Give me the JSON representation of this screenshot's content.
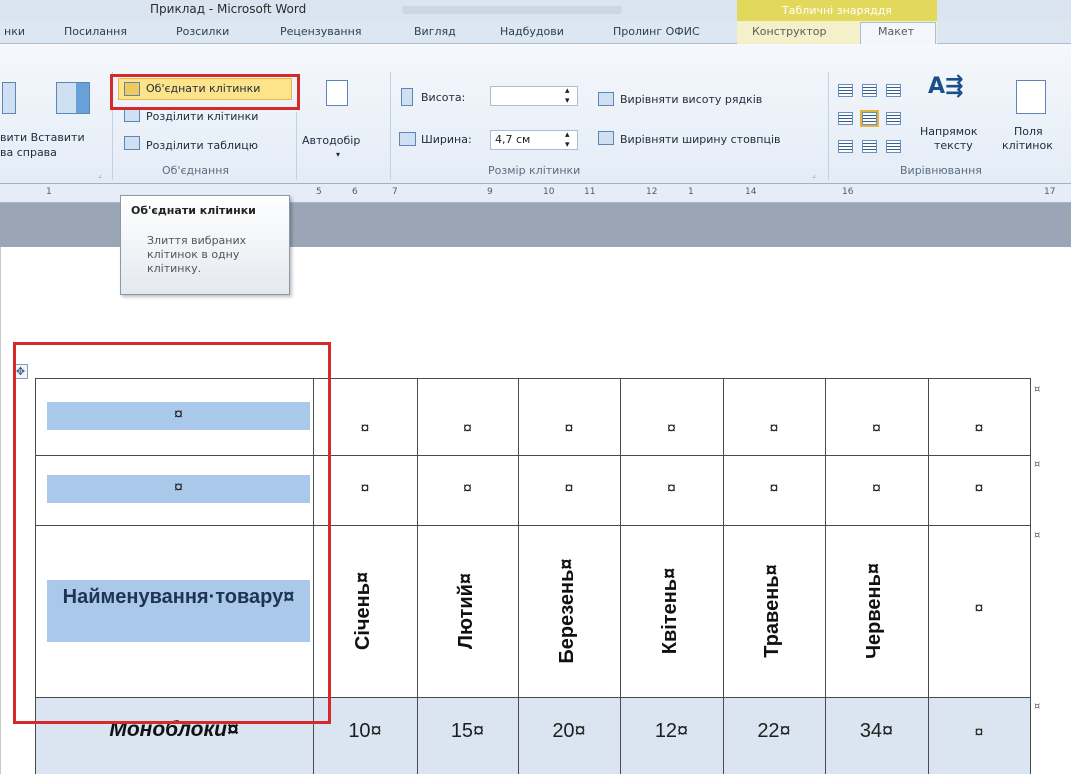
{
  "window": {
    "title": "Приклад - Microsoft Word",
    "context_tools": "Табличні знаряддя"
  },
  "tabs": [
    "нки",
    "Посилання",
    "Розсилки",
    "Рецензування",
    "Вигляд",
    "Надбудови",
    "Пролинг ОФИС",
    "Конструктор",
    "Макет"
  ],
  "ribbon": {
    "insert_right_1": "вити Вставити",
    "insert_right_2": "ва   справа",
    "merge_cells": "Об'єднати клітинки",
    "split_cells": "Розділити клітинки",
    "split_table": "Розділити таблицю",
    "merge_group": "Об'єднання",
    "autofit": "Автодобір",
    "height_label": "Висота:",
    "width_label": "Ширина:",
    "width_value": "4,7 см",
    "dist_rows": "Вирівняти висоту рядків",
    "dist_cols": "Вирівняти ширину стовпців",
    "cell_size_group": "Розмір клітинки",
    "text_direction_1": "Напрямок",
    "text_direction_2": "тексту",
    "cell_margins_1": "Поля",
    "cell_margins_2": "клітинок",
    "alignment_group": "Вирівнювання"
  },
  "ruler": [
    "1",
    "5",
    "6",
    "7",
    "9",
    "10",
    "11",
    "12",
    "1",
    "14",
    "16",
    "17"
  ],
  "tooltip": {
    "title": "Об'єднати клітинки",
    "body": "Злиття вибраних клітинок в одну клітинку."
  },
  "table": {
    "mark": "¤",
    "row1_first": "¤",
    "row2_first": "¤",
    "header_name": "Найменування·товару¤",
    "months": [
      "Січень¤",
      "Лютий¤",
      "Березень¤",
      "Квітень¤",
      "Травень¤",
      "Червень¤"
    ],
    "row3_last": "¤",
    "data_row": {
      "name": "Моноблоки¤",
      "values": [
        "10¤",
        "15¤",
        "20¤",
        "12¤",
        "22¤",
        "34¤"
      ],
      "last": "¤"
    }
  },
  "colors": {
    "highlight_red": "#d42a2a",
    "cell_blue": "#a9c8ea",
    "row_fill": "#dbe5f1"
  }
}
